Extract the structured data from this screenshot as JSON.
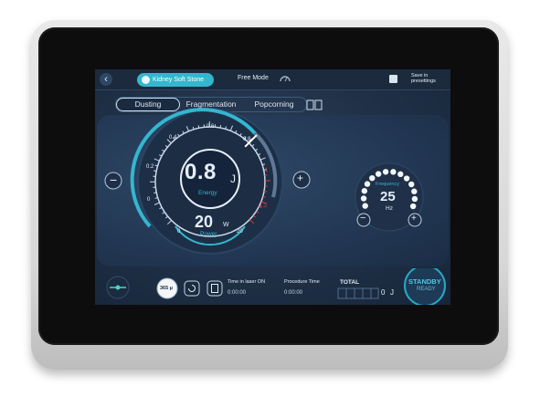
{
  "header": {
    "back_icon": "chevron-left-icon",
    "mode_pill": "Kidney Soft Stone",
    "free_mode": "Free Mode",
    "save_line1": "Save in",
    "save_line2": "presettings"
  },
  "tabs": [
    {
      "label": "Dusting",
      "active": true
    },
    {
      "label": "Fragmentation",
      "active": false
    },
    {
      "label": "Popcorning",
      "active": false
    }
  ],
  "energy": {
    "value": "0.8",
    "unit": "J",
    "label": "Energy",
    "ticks": [
      "0",
      "0.2",
      "0.4",
      "0.6",
      "0.8",
      "1",
      "1.2"
    ],
    "minus": "−",
    "plus": "+"
  },
  "power": {
    "value": "20",
    "unit": "W",
    "label": "Power",
    "min": "0",
    "max": "20"
  },
  "frequency": {
    "label": "Frequency",
    "value": "25",
    "unit": "Hz",
    "minus": "−",
    "plus": "+"
  },
  "footer": {
    "fiber_label": "365 µ",
    "time_laser_label": "Time in laser ON",
    "time_laser_value": "0:00:00",
    "procedure_label": "Procedure Time",
    "procedure_value": "0:00:00",
    "total_label": "TOTAL",
    "total_value": "0",
    "total_unit": "J",
    "standby": "STANDBY",
    "ready": "READY"
  },
  "colors": {
    "accent": "#34b6cf",
    "accent_dark": "#1f8fb0",
    "danger": "#e23a3a",
    "panel": "#223753",
    "standby_ring": "#28a9c6"
  }
}
